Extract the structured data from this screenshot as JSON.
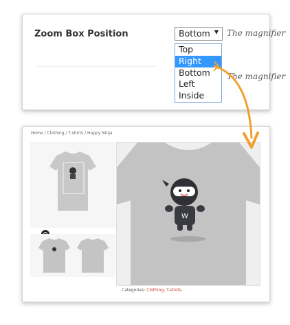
{
  "settings": {
    "label": "Zoom Box Position",
    "selected_value": "Bottom",
    "description": "The magnifier",
    "options": [
      "Top",
      "Right",
      "Bottom",
      "Left",
      "Inside"
    ],
    "highlighted_option": "Right"
  },
  "product": {
    "breadcrumb": "Home / Clothing / T-shirts / Happy Ninja",
    "categories_label": "Categories:",
    "categories_links": "Clothing, T-shirts",
    "categories_end": "."
  },
  "colors": {
    "accent_arrow": "#f0a030",
    "dropdown_highlight": "#3399ff",
    "link": "#c0392b"
  },
  "icons": [
    "caret-down-icon",
    "zoom-icon",
    "arrow-icon"
  ]
}
